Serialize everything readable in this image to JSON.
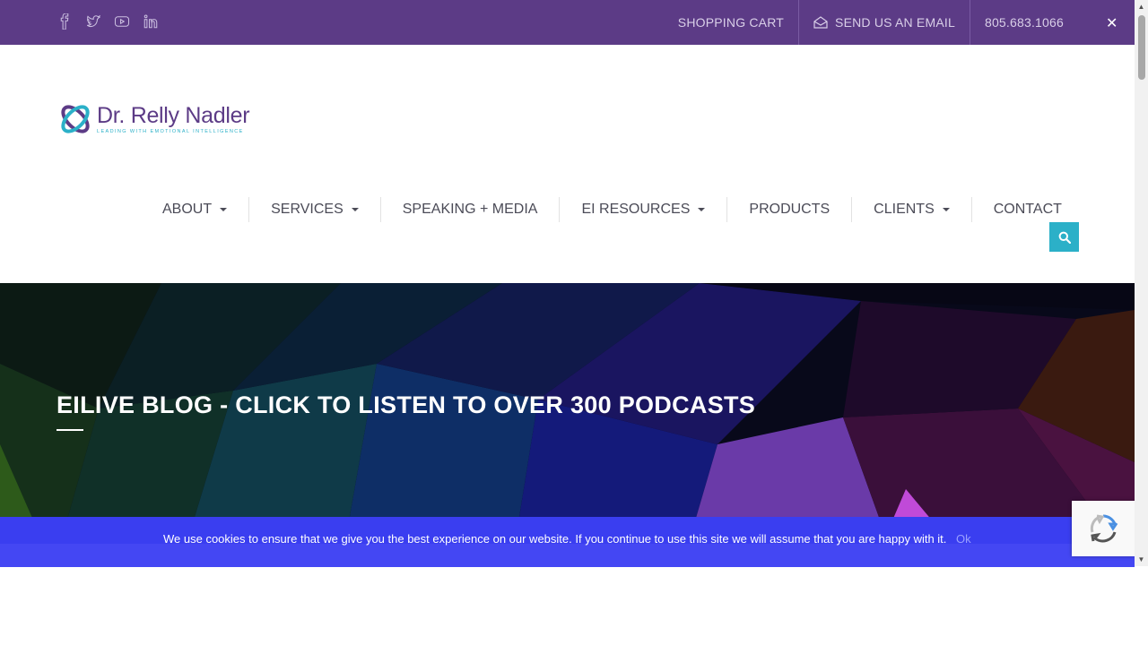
{
  "colors": {
    "topbar": "#5c3b86",
    "accent": "#2bb0c8",
    "nav_text": "#4b4b57",
    "cookie_bg": "#3a3ef0"
  },
  "topbar": {
    "social_icons": [
      "facebook-icon",
      "twitter-icon",
      "youtube-icon",
      "linkedin-icon"
    ],
    "shopping_cart": "SHOPPING CART",
    "email_label": "SEND US AN EMAIL",
    "phone": "805.683.1066"
  },
  "logo": {
    "name": "Dr. Relly Nadler",
    "tagline": "LEADING WITH EMOTIONAL INTELLIGENCE"
  },
  "nav": {
    "items": [
      {
        "label": "ABOUT",
        "has_dropdown": true
      },
      {
        "label": "SERVICES",
        "has_dropdown": true
      },
      {
        "label": "SPEAKING + MEDIA",
        "has_dropdown": false
      },
      {
        "label": "EI RESOURCES",
        "has_dropdown": true
      },
      {
        "label": "PRODUCTS",
        "has_dropdown": false
      },
      {
        "label": "CLIENTS",
        "has_dropdown": true
      },
      {
        "label": "CONTACT",
        "has_dropdown": false
      }
    ],
    "search_icon": "search-icon"
  },
  "hero": {
    "title": "EILIVE BLOG - CLICK TO LISTEN TO OVER 300 PODCASTS"
  },
  "cookie": {
    "message": "We use cookies to ensure that we give you the best experience on our website. If you continue to use this site we will assume that you are happy with it.",
    "ok_label": "Ok",
    "close_glyph": "✕"
  }
}
